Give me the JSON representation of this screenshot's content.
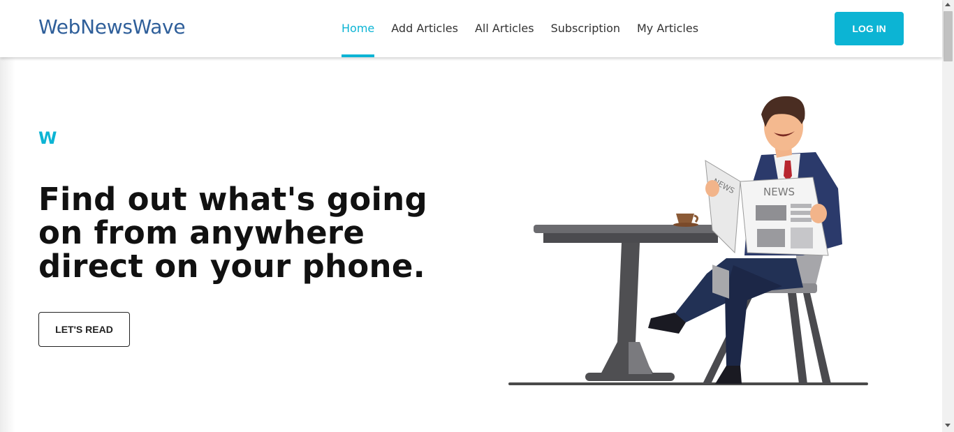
{
  "header": {
    "logo": "WebNewsWave",
    "nav": [
      {
        "label": "Home",
        "active": true
      },
      {
        "label": "Add Articles",
        "active": false
      },
      {
        "label": "All Articles",
        "active": false
      },
      {
        "label": "Subscription",
        "active": false
      },
      {
        "label": "My Articles",
        "active": false
      }
    ],
    "login_label": "LOG IN"
  },
  "hero": {
    "badge": "W",
    "title": "Find out what's going on from anywhere direct on your phone.",
    "cta_label": "LET'S READ",
    "illustration_label": "NEWS"
  },
  "colors": {
    "accent": "#0cb4d4",
    "logo": "#2f5f9a",
    "text_dark": "#111111"
  },
  "icons": [
    "scroll-up-arrow-icon",
    "scroll-down-arrow-icon"
  ]
}
